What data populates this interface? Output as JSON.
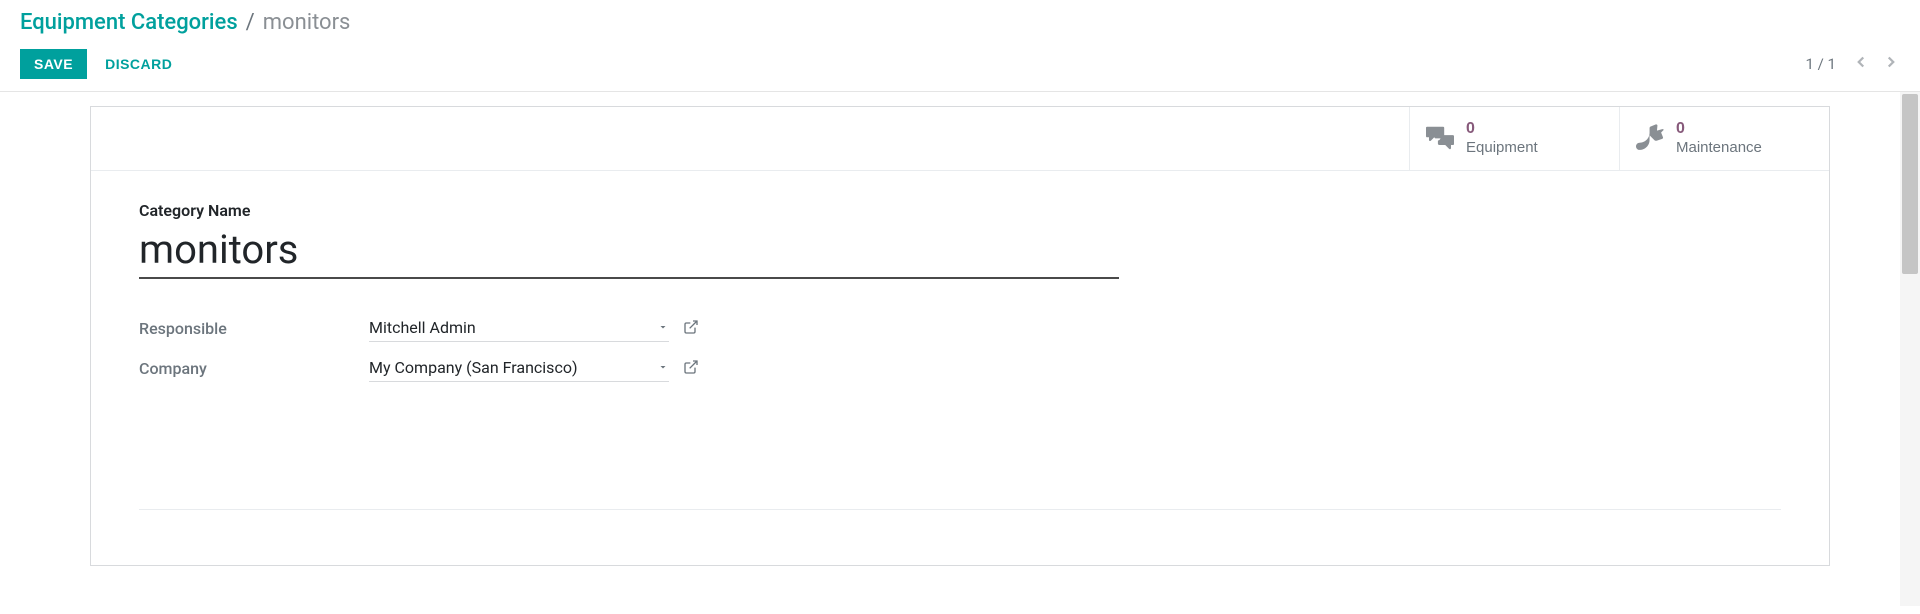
{
  "breadcrumb": {
    "parent": "Equipment Categories",
    "separator": "/",
    "current": "monitors"
  },
  "actions": {
    "save": "Save",
    "discard": "Discard"
  },
  "pager": {
    "text": "1 / 1"
  },
  "stat_buttons": {
    "equipment": {
      "count": "0",
      "label": "Equipment"
    },
    "maintenance": {
      "count": "0",
      "label": "Maintenance"
    }
  },
  "form": {
    "name_label": "Category Name",
    "name_value": "monitors",
    "responsible": {
      "label": "Responsible",
      "value": "Mitchell Admin"
    },
    "company": {
      "label": "Company",
      "value": "My Company (San Francisco)"
    }
  }
}
